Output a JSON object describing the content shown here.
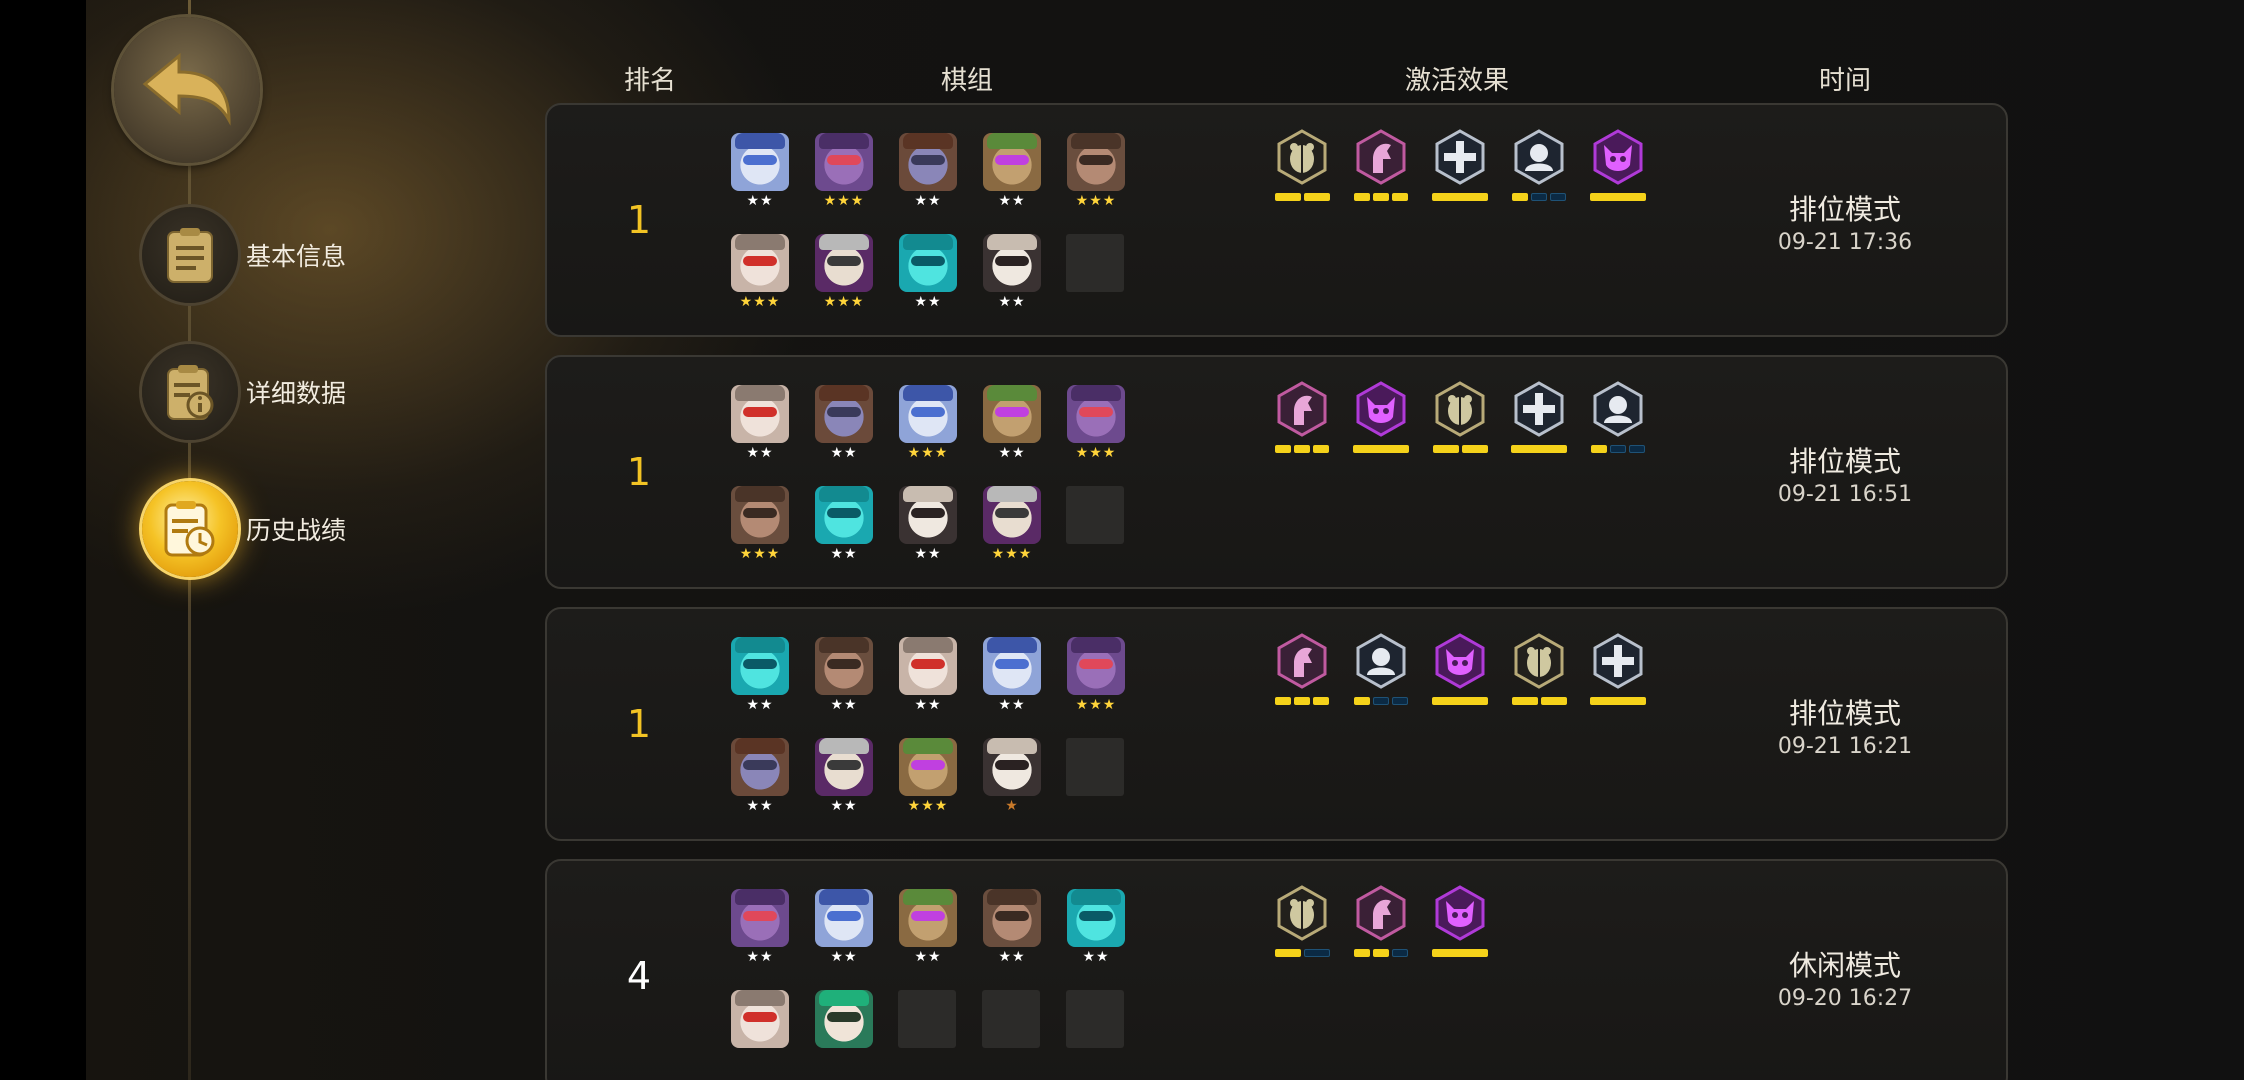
{
  "nav": {
    "back_icon": "back-arrow-icon",
    "items": [
      {
        "label": "基本信息",
        "icon": "notepad-icon",
        "active": false
      },
      {
        "label": "详细数据",
        "icon": "info-document-icon",
        "active": false
      },
      {
        "label": "历史战绩",
        "icon": "history-clock-icon",
        "active": true
      }
    ]
  },
  "headers": {
    "rank": "排名",
    "lineup": "棋组",
    "traits": "激活效果",
    "time": "时间"
  },
  "colors": {
    "gold": "#f2c324",
    "trait_on": "#f5d21a",
    "trait_off": "#0b2a44"
  },
  "matches": [
    {
      "rank": "1",
      "mode": "排位模式",
      "time": "09-21 17:36",
      "pieces": [
        {
          "char": "robot-blue",
          "stars": 2
        },
        {
          "char": "bat-purple",
          "stars": 3
        },
        {
          "char": "troll-hat",
          "stars": 2
        },
        {
          "char": "mummy",
          "stars": 2
        },
        {
          "char": "ogre-brown",
          "stars": 3
        },
        {
          "char": "goblin-red",
          "stars": 3
        },
        {
          "char": "samurai",
          "stars": 3
        },
        {
          "char": "robot-cyan",
          "stars": 2
        },
        {
          "char": "beast-skull",
          "stars": 2
        },
        {
          "char": "empty",
          "stars": 0
        }
      ],
      "traits": [
        {
          "icon": "beetle-icon",
          "ring": "gold",
          "bars": [
            1,
            1
          ]
        },
        {
          "icon": "knight-horse-icon",
          "ring": "pink",
          "bars": [
            1,
            1,
            1
          ]
        },
        {
          "icon": "plus-cross-icon",
          "ring": "silver",
          "bars": [
            1
          ]
        },
        {
          "icon": "mage-hood-icon",
          "ring": "silver",
          "bars": [
            1,
            0,
            0
          ]
        },
        {
          "icon": "demon-mask-icon",
          "ring": "purple",
          "bars": [
            1
          ]
        }
      ]
    },
    {
      "rank": "1",
      "mode": "排位模式",
      "time": "09-21 16:51",
      "pieces": [
        {
          "char": "goblin-red",
          "stars": 2
        },
        {
          "char": "troll-hat",
          "stars": 2
        },
        {
          "char": "robot-blue",
          "stars": 3
        },
        {
          "char": "mummy",
          "stars": 2
        },
        {
          "char": "bat-purple",
          "stars": 3
        },
        {
          "char": "ogre-brown",
          "stars": 3
        },
        {
          "char": "robot-cyan",
          "stars": 2
        },
        {
          "char": "beast-skull",
          "stars": 2
        },
        {
          "char": "samurai",
          "stars": 3
        },
        {
          "char": "empty",
          "stars": 0
        }
      ],
      "traits": [
        {
          "icon": "knight-horse-icon",
          "ring": "pink",
          "bars": [
            1,
            1,
            1
          ]
        },
        {
          "icon": "demon-mask-icon",
          "ring": "purple",
          "bars": [
            1
          ]
        },
        {
          "icon": "beetle-icon",
          "ring": "gold",
          "bars": [
            1,
            1
          ]
        },
        {
          "icon": "plus-cross-icon",
          "ring": "silver",
          "bars": [
            1
          ]
        },
        {
          "icon": "mage-hood-icon",
          "ring": "silver",
          "bars": [
            1,
            0,
            0
          ]
        }
      ]
    },
    {
      "rank": "1",
      "mode": "排位模式",
      "time": "09-21 16:21",
      "pieces": [
        {
          "char": "robot-cyan",
          "stars": 2
        },
        {
          "char": "ogre-brown",
          "stars": 2
        },
        {
          "char": "goblin-red",
          "stars": 2
        },
        {
          "char": "robot-blue",
          "stars": 2
        },
        {
          "char": "bat-purple",
          "stars": 3
        },
        {
          "char": "troll-hat",
          "stars": 2
        },
        {
          "char": "samurai",
          "stars": 2
        },
        {
          "char": "mummy",
          "stars": 3
        },
        {
          "char": "beast-skull",
          "stars": 1
        },
        {
          "char": "empty",
          "stars": 0
        }
      ],
      "traits": [
        {
          "icon": "knight-horse-icon",
          "ring": "pink",
          "bars": [
            1,
            1,
            1
          ]
        },
        {
          "icon": "mage-hood-icon",
          "ring": "silver",
          "bars": [
            1,
            0,
            0
          ]
        },
        {
          "icon": "demon-mask-icon",
          "ring": "purple",
          "bars": [
            1
          ]
        },
        {
          "icon": "beetle-icon",
          "ring": "gold",
          "bars": [
            1,
            1
          ]
        },
        {
          "icon": "plus-cross-icon",
          "ring": "silver",
          "bars": [
            1
          ]
        }
      ]
    },
    {
      "rank": "4",
      "mode": "休闲模式",
      "time": "09-20 16:27",
      "pieces": [
        {
          "char": "bat-purple",
          "stars": 2
        },
        {
          "char": "robot-blue",
          "stars": 2
        },
        {
          "char": "mummy",
          "stars": 2
        },
        {
          "char": "ogre-brown",
          "stars": 2
        },
        {
          "char": "robot-cyan",
          "stars": 2
        },
        {
          "char": "goblin-red",
          "stars": 0
        },
        {
          "char": "green-hair",
          "stars": 0
        },
        {
          "char": "empty",
          "stars": 0
        },
        {
          "char": "empty",
          "stars": 0
        },
        {
          "char": "empty",
          "stars": 0
        }
      ],
      "traits": [
        {
          "icon": "beetle-icon",
          "ring": "gold",
          "bars": [
            1,
            0
          ]
        },
        {
          "icon": "knight-horse-icon",
          "ring": "pink",
          "bars": [
            1,
            1,
            0
          ]
        },
        {
          "icon": "demon-mask-icon",
          "ring": "purple",
          "bars": [
            1
          ]
        }
      ]
    }
  ]
}
